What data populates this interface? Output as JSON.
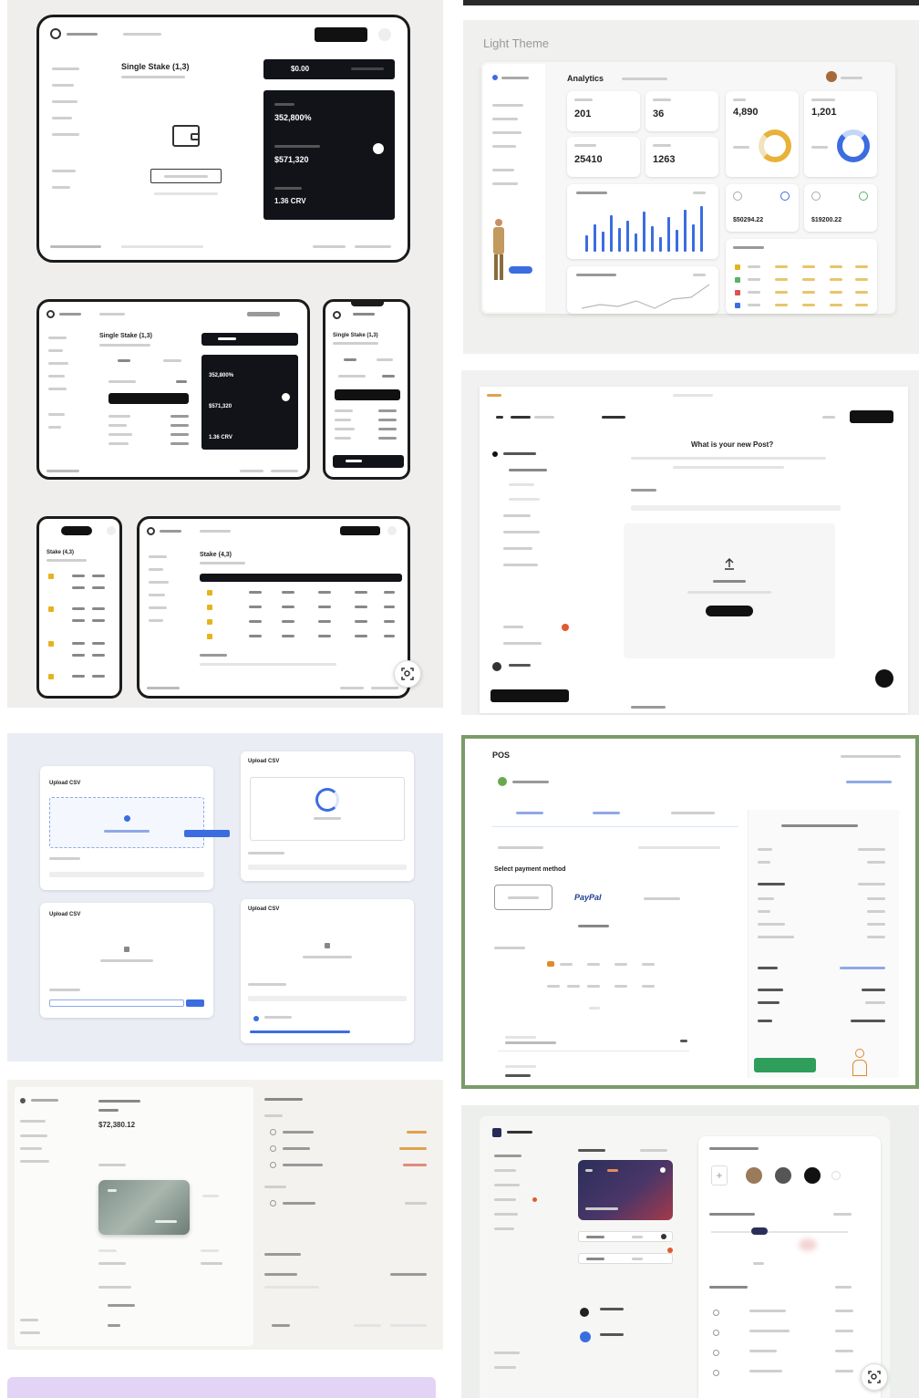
{
  "tile1": {
    "large_tablet": {
      "title": "Single Stake (1,3)",
      "balance": "$0.00",
      "stat1": "352,800%",
      "stat2": "$571,320",
      "stat3": "1.36 CRV"
    },
    "tablet": {
      "title": "Single Stake (1,3)",
      "stat1": "352,800%",
      "stat2": "$571,320",
      "stat3": "1.36 CRV"
    },
    "phone": {
      "title": "Single Stake (1,3)"
    },
    "small_phone": {
      "title": "Stake (4,3)"
    },
    "small_tablet": {
      "title": "Stake (4,3)"
    }
  },
  "tile2": {
    "heading": "Light Theme",
    "section": "Analytics",
    "stats": [
      "201",
      "36",
      "25410",
      "1263"
    ],
    "big_stats": [
      "4,890",
      "1,201"
    ],
    "amounts": [
      "$50294.22",
      "$19200.22"
    ]
  },
  "tile3": {
    "question": "What is your new Post?"
  },
  "tile4": {
    "panels": [
      "Upload CSV",
      "Upload CSV",
      "Upload CSV",
      "Upload CSV"
    ]
  },
  "tile5": {
    "logo": "POS",
    "heading": "Select payment method",
    "paypal": "PayPal"
  },
  "tile6": {
    "amount": "$72,380.12"
  },
  "icon_names": {
    "lens": "visual-search-icon",
    "plus": "plus-icon",
    "wallet": "wallet-icon"
  },
  "colors": {
    "accent_blue": "#3b6de0",
    "dark": "#111319",
    "gold": "#e5b31e",
    "green_border": "#7b9a6a"
  }
}
